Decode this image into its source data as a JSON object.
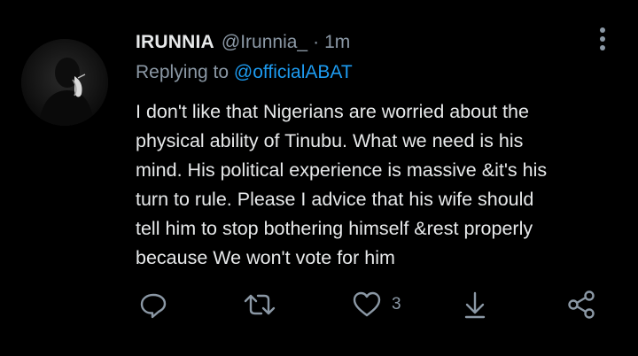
{
  "tweet": {
    "display_name": "IRUNNIA",
    "handle": "@Irunnia_",
    "separator": "·",
    "time": "1m",
    "reply_prefix": "Replying to",
    "reply_mention": "@officialABAT",
    "body_lines": [
      "I don't like that Nigerians are worried about the",
      "physical ability of Tinubu. What we need is his",
      "mind. His political experience is massive &it's his",
      "turn to rule. Please I advice that his wife should",
      "tell him to stop bothering himself &rest properly",
      "because We won't vote for him"
    ],
    "like_count": "3"
  },
  "icons": {
    "more": "more-vertical-icon",
    "reply": "reply-icon",
    "retweet": "retweet-icon",
    "like": "heart-icon",
    "download": "download-icon",
    "share": "share-icon"
  },
  "colors": {
    "background": "#000000",
    "text": "#e7e9ea",
    "secondary": "#8b98a5",
    "accent": "#1d9bf0"
  }
}
